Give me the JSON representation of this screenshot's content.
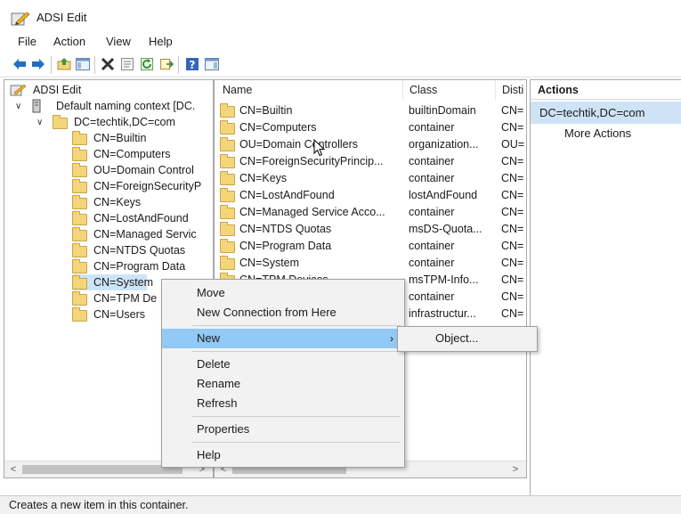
{
  "window": {
    "title": "ADSI Edit"
  },
  "menubar": {
    "items": [
      "File",
      "Action",
      "View",
      "Help"
    ]
  },
  "toolbar": {
    "icons": [
      "back-arrow-icon",
      "forward-arrow-icon",
      "up-folder-icon",
      "show-hide-console-tree-icon",
      "delete-icon",
      "properties-icon",
      "refresh-icon",
      "export-list-icon",
      "help-icon",
      "show-action-pane-icon"
    ]
  },
  "tree": {
    "root": "ADSI Edit",
    "context": "Default naming context [DC.",
    "domain": "DC=techtik,DC=com",
    "items": [
      "CN=Builtin",
      "CN=Computers",
      "OU=Domain Control",
      "CN=ForeignSecurityP",
      "CN=Keys",
      "CN=LostAndFound",
      "CN=Managed Servic",
      "CN=NTDS Quotas",
      "CN=Program Data",
      "CN=System",
      "CN=TPM De",
      "CN=Users"
    ],
    "selected_index": 9
  },
  "list": {
    "columns": [
      "Name",
      "Class",
      "Disti"
    ],
    "rows": [
      {
        "name": "CN=Builtin",
        "class": "builtinDomain",
        "dn": "CN="
      },
      {
        "name": "CN=Computers",
        "class": "container",
        "dn": "CN="
      },
      {
        "name": "OU=Domain Controllers",
        "class": "organization...",
        "dn": "OU="
      },
      {
        "name": "CN=ForeignSecurityPrincip...",
        "class": "container",
        "dn": "CN="
      },
      {
        "name": "CN=Keys",
        "class": "container",
        "dn": "CN="
      },
      {
        "name": "CN=LostAndFound",
        "class": "lostAndFound",
        "dn": "CN="
      },
      {
        "name": "CN=Managed Service Acco...",
        "class": "container",
        "dn": "CN="
      },
      {
        "name": "CN=NTDS Quotas",
        "class": "msDS-Quota...",
        "dn": "CN="
      },
      {
        "name": "CN=Program Data",
        "class": "container",
        "dn": "CN="
      },
      {
        "name": "CN=System",
        "class": "container",
        "dn": "CN="
      },
      {
        "name": "CN=TPM Devices",
        "class": "msTPM-Info...",
        "dn": "CN="
      },
      {
        "name": "",
        "class": "container",
        "dn": "CN="
      },
      {
        "name": "",
        "class": "infrastructur...",
        "dn": "CN="
      }
    ]
  },
  "actions": {
    "header": "Actions",
    "selected": "DC=techtik,DC=com",
    "more": "More Actions"
  },
  "context_menu": {
    "items": [
      "Move",
      "New Connection from Here",
      "New",
      "Delete",
      "Rename",
      "Refresh",
      "Properties",
      "Help"
    ],
    "highlighted": "New",
    "submenu": [
      "Object..."
    ]
  },
  "status": {
    "text": "Creates a new item in this container."
  },
  "colors": {
    "highlight": "#91c9f7",
    "actions_selected": "#cfe3f6",
    "folder": "#f5d57a"
  }
}
